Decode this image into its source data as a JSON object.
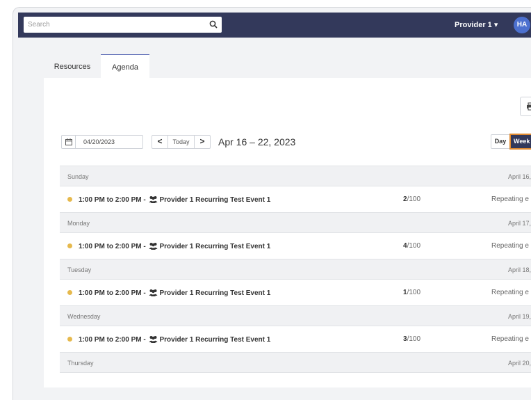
{
  "header": {
    "search_placeholder": "Search",
    "provider_label": "Provider 1 ▾",
    "avatar_initials": "HA",
    "bar_color": "#33395b"
  },
  "tabs": [
    {
      "label": "Resources",
      "active": false
    },
    {
      "label": "Agenda",
      "active": true
    }
  ],
  "toolbar": {
    "date_value": "04/20/2023",
    "prev_label": "<",
    "today_label": "Today",
    "next_label": ">",
    "range_label": "Apr 16 – 22, 2023",
    "day_label": "Day",
    "week_label": "Week",
    "print_icon": "print-icon"
  },
  "agenda": {
    "days": [
      {
        "name": "Sunday",
        "date": "April 16,",
        "event": {
          "title": "1:00 PM to 2:00 PM - ",
          "resource": "Provider 1 Recurring Test Event 1",
          "count": "2",
          "capacity": "/100",
          "status": "Repeating e"
        }
      },
      {
        "name": "Monday",
        "date": "April 17,",
        "event": {
          "title": "1:00 PM to 2:00 PM - ",
          "resource": "Provider 1 Recurring Test Event 1",
          "count": "4",
          "capacity": "/100",
          "status": "Repeating e"
        }
      },
      {
        "name": "Tuesday",
        "date": "April 18,",
        "event": {
          "title": "1:00 PM to 2:00 PM - ",
          "resource": "Provider 1 Recurring Test Event 1",
          "count": "1",
          "capacity": "/100",
          "status": "Repeating e"
        }
      },
      {
        "name": "Wednesday",
        "date": "April 19,",
        "event": {
          "title": "1:00 PM to 2:00 PM - ",
          "resource": "Provider 1 Recurring Test Event 1",
          "count": "3",
          "capacity": "/100",
          "status": "Repeating e"
        }
      },
      {
        "name": "Thursday",
        "date": "April 20,"
      }
    ]
  }
}
